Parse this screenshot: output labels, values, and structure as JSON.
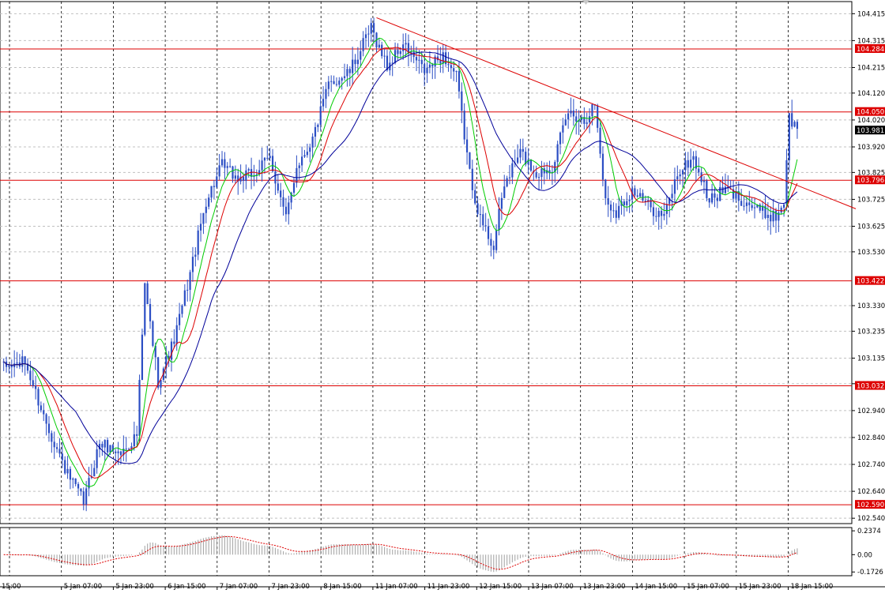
{
  "chart_data": {
    "type": "candlestick",
    "price_axis": {
      "ylim": [
        102.52,
        104.46
      ],
      "ticks": [
        104.415,
        104.315,
        104.215,
        104.12,
        104.02,
        103.92,
        103.825,
        103.725,
        103.625,
        103.53,
        103.33,
        103.235,
        103.135,
        103.04,
        102.94,
        102.84,
        102.74,
        102.64,
        102.54
      ],
      "tick_labels": [
        "104.415",
        "104.315",
        "104.215",
        "104.120",
        "104.020",
        "103.920",
        "103.825",
        "103.725",
        "103.625",
        "103.530",
        "103.330",
        "103.235",
        "103.135",
        "103.040",
        "102.940",
        "102.840",
        "102.740",
        "102.640",
        "102.540"
      ]
    },
    "time_axis": {
      "labels": [
        "15:00",
        "5 Jan 07:00",
        "5 Jan 23:00",
        "6 Jan 15:00",
        "7 Jan 07:00",
        "7 Jan 23:00",
        "8 Jan 15:00",
        "11 Jan 07:00",
        "11 Jan 23:00",
        "12 Jan 15:00",
        "13 Jan 07:00",
        "13 Jan 23:00",
        "14 Jan 15:00",
        "15 Jan 07:00",
        "15 Jan 23:00",
        "18 Jan 15:00"
      ],
      "n_bars": 300
    },
    "levels": [
      {
        "value": 104.284,
        "label": "104.284"
      },
      {
        "value": 104.05,
        "label": "104.050"
      },
      {
        "value": 103.796,
        "label": "103.796"
      },
      {
        "value": 103.422,
        "label": "103.422"
      },
      {
        "value": 103.032,
        "label": "103.032"
      },
      {
        "value": 102.59,
        "label": "102.590"
      }
    ],
    "current_price": {
      "value": 103.981,
      "label": "103.981"
    },
    "trendline": {
      "start": [
        140,
        104.4
      ],
      "end": [
        320,
        103.69
      ]
    },
    "price_path": [
      [
        0,
        103.1
      ],
      [
        8,
        103.12
      ],
      [
        15,
        102.92
      ],
      [
        24,
        102.7
      ],
      [
        30,
        102.6
      ],
      [
        36,
        102.82
      ],
      [
        44,
        102.78
      ],
      [
        50,
        102.85
      ],
      [
        53,
        103.4
      ],
      [
        58,
        103.05
      ],
      [
        64,
        103.2
      ],
      [
        70,
        103.45
      ],
      [
        76,
        103.72
      ],
      [
        82,
        103.85
      ],
      [
        88,
        103.8
      ],
      [
        94,
        103.82
      ],
      [
        100,
        103.88
      ],
      [
        106,
        103.65
      ],
      [
        110,
        103.85
      ],
      [
        116,
        103.95
      ],
      [
        122,
        104.15
      ],
      [
        130,
        104.2
      ],
      [
        138,
        104.36
      ],
      [
        144,
        104.22
      ],
      [
        150,
        104.3
      ],
      [
        158,
        104.2
      ],
      [
        165,
        104.26
      ],
      [
        170,
        104.18
      ],
      [
        175,
        103.82
      ],
      [
        179,
        103.65
      ],
      [
        184,
        103.55
      ],
      [
        188,
        103.78
      ],
      [
        194,
        103.9
      ],
      [
        200,
        103.82
      ],
      [
        206,
        103.85
      ],
      [
        212,
        104.05
      ],
      [
        218,
        104.02
      ],
      [
        222,
        104.08
      ],
      [
        226,
        103.72
      ],
      [
        230,
        103.68
      ],
      [
        236,
        103.76
      ],
      [
        242,
        103.7
      ],
      [
        248,
        103.66
      ],
      [
        253,
        103.82
      ],
      [
        259,
        103.88
      ],
      [
        265,
        103.72
      ],
      [
        271,
        103.76
      ],
      [
        278,
        103.72
      ],
      [
        284,
        103.68
      ],
      [
        290,
        103.66
      ],
      [
        293,
        103.72
      ],
      [
        295,
        104.03
      ],
      [
        298,
        103.98
      ]
    ],
    "moving_averages": [
      {
        "color": "#00cc00",
        "period": 8
      },
      {
        "color": "#dd0000",
        "period": 14
      },
      {
        "color": "#000099",
        "period": 28
      }
    ],
    "oscillator": {
      "ticks": [
        0.2374,
        0.0,
        -0.1726
      ],
      "tick_labels": [
        "0.2374",
        "0.00",
        "-0.1726"
      ],
      "ylim": [
        -0.21,
        0.27
      ]
    },
    "colors": {
      "candle": "#2b4ec4",
      "level": "#dd0000",
      "grid": "#c0c0c0",
      "ma_fast": "#00cc00",
      "ma_mid": "#dd0000",
      "ma_slow": "#000099",
      "osc_hist": "#a8a8a8",
      "osc_signal": "#dd0000"
    }
  }
}
